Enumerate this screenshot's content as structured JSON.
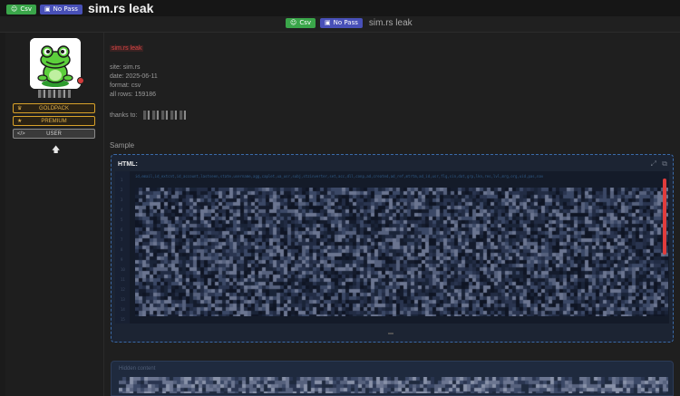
{
  "topbar": {
    "badge_csv": "Csv",
    "badge_nopass": "No Pass",
    "title": "sim.rs leak"
  },
  "subheader": {
    "badge_csv": "Csv",
    "badge_nopass": "No Pass",
    "title": "sim.rs leak"
  },
  "sidebar": {
    "ranks": {
      "goldpack": "GOLDPACK",
      "premium": "PREMIUM",
      "user": "USER"
    },
    "status_color": "#d23b3b"
  },
  "post": {
    "tag": "sim.rs leak",
    "site": "site: sim.rs",
    "date": "date: 2025-06-11",
    "format": "format: csv",
    "rows": "all rows: 159186",
    "thanks": "thanks to:",
    "sample_label": "Sample"
  },
  "code": {
    "header": "HTML:",
    "first_line": "id,email,id_extcnt,id_account,lastseen,state,username,agg,caplet,ua_usr,subj,stzinverter,set,acc,dll,conp,ad,created,ad_ref,mtrtm,ad_id,usr,flg,sin,dat,grp,lkn,res,lvl,mrg,org,uid,pas,nav",
    "line_numbers": [
      "1",
      "2",
      "3",
      "4",
      "5",
      "6",
      "7",
      "8",
      "9",
      "10",
      "11",
      "12",
      "13",
      "14",
      "15"
    ]
  },
  "hidden_block": {
    "label": "Hidden content"
  },
  "colors": {
    "accent_green": "#3aa64a",
    "accent_blue": "#4850b8",
    "gold": "#d9a22a",
    "scrollbar": "#e03c3c",
    "code_border": "#3b6aa8"
  },
  "icons": {
    "csv": "user-icon",
    "nopass": "lock-icon",
    "expand": "expand-icon",
    "copy": "copy-icon",
    "up": "arrow-up-icon"
  }
}
